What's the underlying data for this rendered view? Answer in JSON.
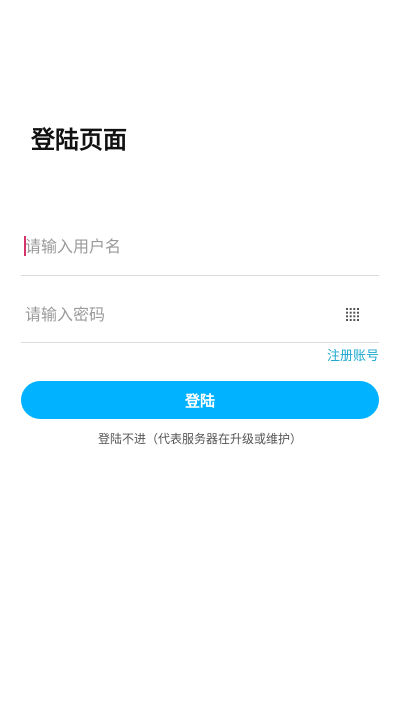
{
  "page": {
    "title": "登陆页面"
  },
  "form": {
    "username": {
      "placeholder": "请输入用户名",
      "value": ""
    },
    "password": {
      "placeholder": "请输入密码",
      "value": "",
      "keypad_icon": "keypad-icon"
    },
    "register_label": "注册账号",
    "login_label": "登陆",
    "notice": "登陆不进（代表服务器在升级或维护）"
  },
  "colors": {
    "accent": "#00b2ff",
    "link": "#1ba9cf",
    "caret": "#d6336c"
  }
}
